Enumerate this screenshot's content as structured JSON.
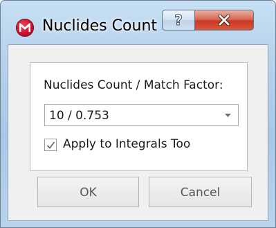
{
  "window": {
    "title": "Nuclides Count",
    "app_icon": "app-logo-icon",
    "help_icon": "help-icon",
    "help_glyph": "?",
    "close_icon": "close-icon"
  },
  "form": {
    "field_label": "Nuclides Count / Match Factor:",
    "selected_value": "10 / 0.753",
    "checkbox_label": "Apply to Integrals Too",
    "checkbox_checked": true
  },
  "buttons": {
    "ok_label": "OK",
    "cancel_label": "Cancel"
  },
  "colors": {
    "accent_red": "#c8102e",
    "close_red": "#c83a22",
    "frame_blue": "#a9c7e4"
  }
}
